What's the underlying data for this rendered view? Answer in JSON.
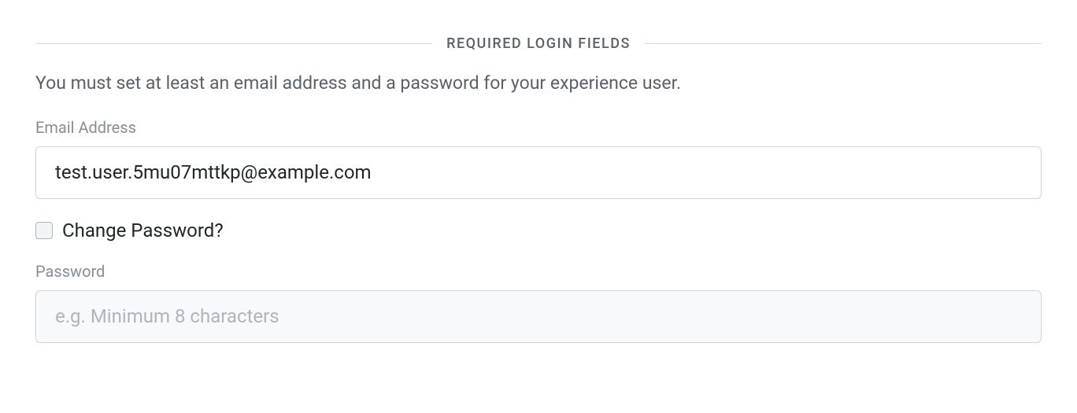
{
  "section": {
    "title": "REQUIRED LOGIN FIELDS",
    "description": "You must set at least an email address and a password for your experience user."
  },
  "fields": {
    "email": {
      "label": "Email Address",
      "value": "test.user.5mu07mttkp@example.com",
      "placeholder": ""
    },
    "changePassword": {
      "label": "Change Password?",
      "checked": false
    },
    "password": {
      "label": "Password",
      "value": "",
      "placeholder": "e.g. Minimum 8 characters"
    }
  }
}
